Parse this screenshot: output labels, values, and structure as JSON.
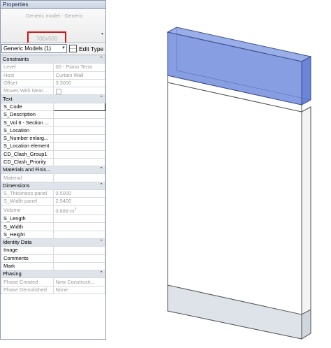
{
  "palette": {
    "title": "Properties",
    "type_name": "Generic model - Generic",
    "type_dims": "700x500",
    "instance_selector": "Generic Models (1)",
    "edit_type_label": "Edit Type"
  },
  "sections": {
    "constraints": "Constraints",
    "text": "Text",
    "materials": "Materials and Finis...",
    "dimensions": "Dimensions",
    "identity": "Identity Data",
    "phasing": "Phasing"
  },
  "rows": {
    "level": {
      "label": "Level",
      "value": "00 - Piano Terra"
    },
    "host": {
      "label": "Host",
      "value": "Curtain Wall"
    },
    "offset": {
      "label": "Offset",
      "value": "3.3000"
    },
    "moves_with": {
      "label": "Moves With Near..."
    },
    "s_code": {
      "label": "S_Code",
      "value": ""
    },
    "s_description": {
      "label": "S_Description",
      "value": ""
    },
    "s_vol6": {
      "label": "S_Vol 6 - Section ...",
      "value": ""
    },
    "s_location": {
      "label": "S_Location",
      "value": ""
    },
    "s_number": {
      "label": "S_Number enlarg...",
      "value": ""
    },
    "s_location_element": {
      "label": "S_Location element",
      "value": ""
    },
    "cd_clash_group1": {
      "label": "CD_Clash_Group1",
      "value": ""
    },
    "cd_clash_priority": {
      "label": "CD_Clash_Priority",
      "value": ""
    },
    "material": {
      "label": "Material",
      "value": ""
    },
    "s_thickness": {
      "label": "S_Thickness panel",
      "value": "0.5000"
    },
    "s_width_panel": {
      "label": "S_Width panel",
      "value": "2.5400"
    },
    "volume": {
      "label": "Volume",
      "value": "0.889 m",
      "unit_sup": "3"
    },
    "s_length": {
      "label": "S_Length",
      "value": ""
    },
    "s_width": {
      "label": "S_Width",
      "value": ""
    },
    "s_height": {
      "label": "S_Height",
      "value": ""
    },
    "image": {
      "label": "Image",
      "value": ""
    },
    "comments": {
      "label": "Comments",
      "value": ""
    },
    "mark": {
      "label": "Mark",
      "value": ""
    },
    "phase_created": {
      "label": "Phase Created",
      "value": "New Constructi..."
    },
    "phase_demolished": {
      "label": "Phase Demolished",
      "value": "None"
    }
  },
  "colors": {
    "selection_blue": "#7b93e0",
    "bottom_band": "#dde3e8"
  }
}
